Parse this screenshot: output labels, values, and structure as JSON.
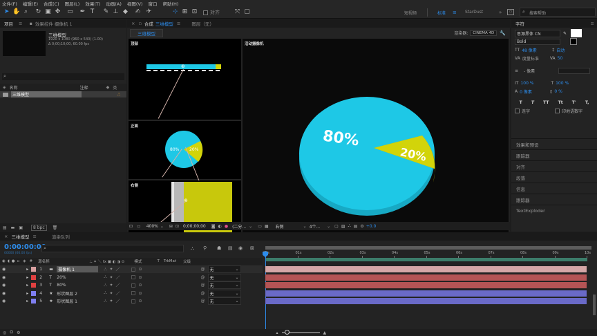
{
  "menu": [
    "文件(F)",
    "编辑(E)",
    "合成(C)",
    "图层(L)",
    "效果(T)",
    "动画(A)",
    "视图(V)",
    "窗口",
    "帮助(H)"
  ],
  "toolbar": {
    "align_label": "对齐",
    "workspaces": [
      "短视频",
      "标准",
      "StarDust"
    ],
    "active_workspace": "标准",
    "search_placeholder": "搜索帮助"
  },
  "project": {
    "tab": "项目",
    "effects_tab": "效果控件 摄像机 1",
    "item_name": "三维模型",
    "item_info1": "1920 x 1080 (960 x 540) (1.00)",
    "item_info2": "Δ 0;00;10;00, 60.00 fps",
    "search_placeholder": "",
    "col_name": "名称",
    "col_note": "注释",
    "row_name": "三维模型",
    "bpc": "8 bpc"
  },
  "comp": {
    "tab_label": "合成",
    "tab_name": "三维模型",
    "layer_tab": "图层（无）",
    "flowchip": "三维模型",
    "renderer_label": "渲染器:",
    "renderer": "CINEMA 4D",
    "view_top": "顶部",
    "view_front": "正面",
    "view_right": "右侧",
    "view_active": "活动摄像机",
    "pie_big": "80%",
    "pie_small": "20%",
    "pie_mini_big": "80%",
    "pie_mini_small": "20%",
    "zoom": "400%",
    "timecode": "0;00;00;00",
    "resolution": "(二分...",
    "view_sel": "右侧",
    "views": "4个...",
    "exposure": "+0.0"
  },
  "character": {
    "tab": "字符",
    "font": "思源黑体 CN",
    "style": "Bold",
    "size": "48 像素",
    "leading_label": "自动",
    "kern": "度量标准",
    "track": "50",
    "stroke": "- 像素",
    "vscale": "100 %",
    "hscale": "100 %",
    "baseline": "0 像素",
    "tsume": "0 %",
    "ligature_label": "连字",
    "hindi_label": "印地语数字",
    "styles": [
      "T",
      "T",
      "TT",
      "Tt",
      "T'",
      "T,"
    ]
  },
  "panels": [
    "效果和预设",
    "跟踪器",
    "对齐",
    "段落",
    "信息",
    "跟踪器",
    "TextExploder"
  ],
  "timeline": {
    "tab": "三维模型",
    "render_tab": "渲染队列",
    "timecode": "0:00:00:00",
    "timecode_sub": "00000 (60.00 fps)",
    "cols": {
      "name": "源名称",
      "mode": "模式",
      "t": "T",
      "trkmat": "TrkMat",
      "parent": "父级"
    },
    "ruler": [
      "00s",
      "01s",
      "02s",
      "03s",
      "04s",
      "05s",
      "06s",
      "07s",
      "08s",
      "09s",
      "10s"
    ],
    "layers": [
      {
        "num": "1",
        "name": "摄像机 1",
        "color": "#d8a0a0",
        "bar": "#d5a7a7",
        "type": "camera",
        "parent": "无"
      },
      {
        "num": "2",
        "name": "20%",
        "color": "#e04040",
        "bar": "#b45455",
        "type": "text",
        "parent": "无"
      },
      {
        "num": "3",
        "name": "80%",
        "color": "#e04040",
        "bar": "#b45455",
        "type": "text",
        "parent": "无"
      },
      {
        "num": "4",
        "name": "形状图层 2",
        "color": "#7f7ff0",
        "bar": "#6a6ac8",
        "type": "shape",
        "parent": "无"
      },
      {
        "num": "5",
        "name": "形状图层 1",
        "color": "#7f7ff0",
        "bar": "#6a6ac8",
        "type": "shape",
        "parent": "无"
      }
    ]
  },
  "colors": {
    "accent": "#2d8ceb",
    "pie_blue": "#1ec8e6",
    "pie_yellow": "#d2d40a"
  }
}
